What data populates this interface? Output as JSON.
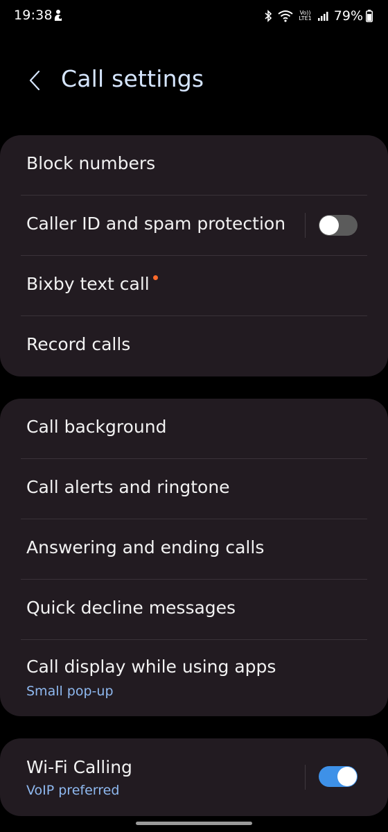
{
  "status_bar": {
    "time": "19:38",
    "left_icon": "notification-app-icon",
    "icons": [
      "bluetooth-icon",
      "wifi-icon",
      "volte-lte-icon",
      "signal-icon"
    ],
    "volte_top": "Vo))",
    "volte_bottom": "LTE1",
    "battery_percent": "79%",
    "battery_level": 0.79
  },
  "header": {
    "back_icon": "back-arrow-icon",
    "title": "Call settings"
  },
  "sections": [
    {
      "items": [
        {
          "title": "Block numbers"
        },
        {
          "title": "Caller ID and spam protection",
          "toggle": false
        },
        {
          "title": "Bixby text call",
          "badge": "new-dot"
        },
        {
          "title": "Record calls"
        }
      ]
    },
    {
      "items": [
        {
          "title": "Call background"
        },
        {
          "title": "Call alerts and ringtone"
        },
        {
          "title": "Answering and ending calls"
        },
        {
          "title": "Quick decline messages"
        },
        {
          "title": "Call display while using apps",
          "subtitle": "Small pop-up"
        }
      ]
    },
    {
      "items": [
        {
          "title": "Wi-Fi Calling",
          "subtitle": "VoIP preferred",
          "toggle": true
        }
      ]
    }
  ],
  "colors": {
    "background": "#000000",
    "card": "#221b21",
    "title_accent": "#d6e6ff",
    "subtitle_accent": "#8fb9f0",
    "toggle_on": "#3e91e8",
    "toggle_off": "#5b5b5b",
    "badge_dot": "#ff6a2b"
  }
}
